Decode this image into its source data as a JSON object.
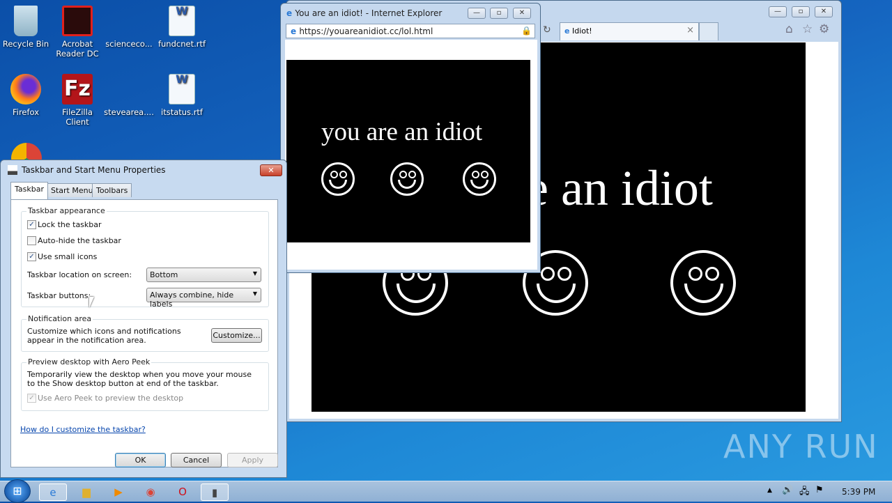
{
  "desktop": {
    "icons": [
      {
        "label": "Recycle Bin",
        "icon": "recycle-bin-icon"
      },
      {
        "label": "Acrobat Reader DC",
        "icon": "acrobat-icon"
      },
      {
        "label": "scienceco...",
        "icon": "blank-file-icon"
      },
      {
        "label": "fundcnet.rtf",
        "icon": "word-doc-icon"
      },
      {
        "label": "Firefox",
        "icon": "firefox-icon"
      },
      {
        "label": "FileZilla Client",
        "icon": "filezilla-icon"
      },
      {
        "label": "stevearea....",
        "icon": "blank-file-icon"
      },
      {
        "label": "itstatus.rtf",
        "icon": "word-doc-icon"
      }
    ]
  },
  "ie_main": {
    "tab_title": "Idiot!",
    "page_text": "e an idiot",
    "tab_close": "×"
  },
  "ie_popup": {
    "title": "You are an idiot! - Internet Explorer",
    "url": "https://youareanidiot.cc/lol.html",
    "page_text": "you are an idiot"
  },
  "dialog": {
    "title": "Taskbar and Start Menu Properties",
    "tabs": [
      "Taskbar",
      "Start Menu",
      "Toolbars"
    ],
    "appearance": {
      "legend": "Taskbar appearance",
      "lock": {
        "label": "Lock the taskbar",
        "checked": true
      },
      "autohide": {
        "label": "Auto-hide the taskbar",
        "checked": false
      },
      "small": {
        "label": "Use small icons",
        "checked": true
      },
      "location_label": "Taskbar location on screen:",
      "location_value": "Bottom",
      "buttons_label": "Taskbar buttons:",
      "buttons_value": "Always combine, hide labels"
    },
    "notification": {
      "legend": "Notification area",
      "text": "Customize which icons and notifications appear in the notification area.",
      "button": "Customize..."
    },
    "peek": {
      "legend": "Preview desktop with Aero Peek",
      "text": "Temporarily view the desktop when you move your mouse to the Show desktop button at end of the taskbar.",
      "checkbox": "Use Aero Peek to preview the desktop"
    },
    "help_link": "How do I customize the taskbar?",
    "ok": "OK",
    "cancel": "Cancel",
    "apply": "Apply"
  },
  "taskbar": {
    "clock": "5:39 PM"
  },
  "watermark": "ANY RUN"
}
